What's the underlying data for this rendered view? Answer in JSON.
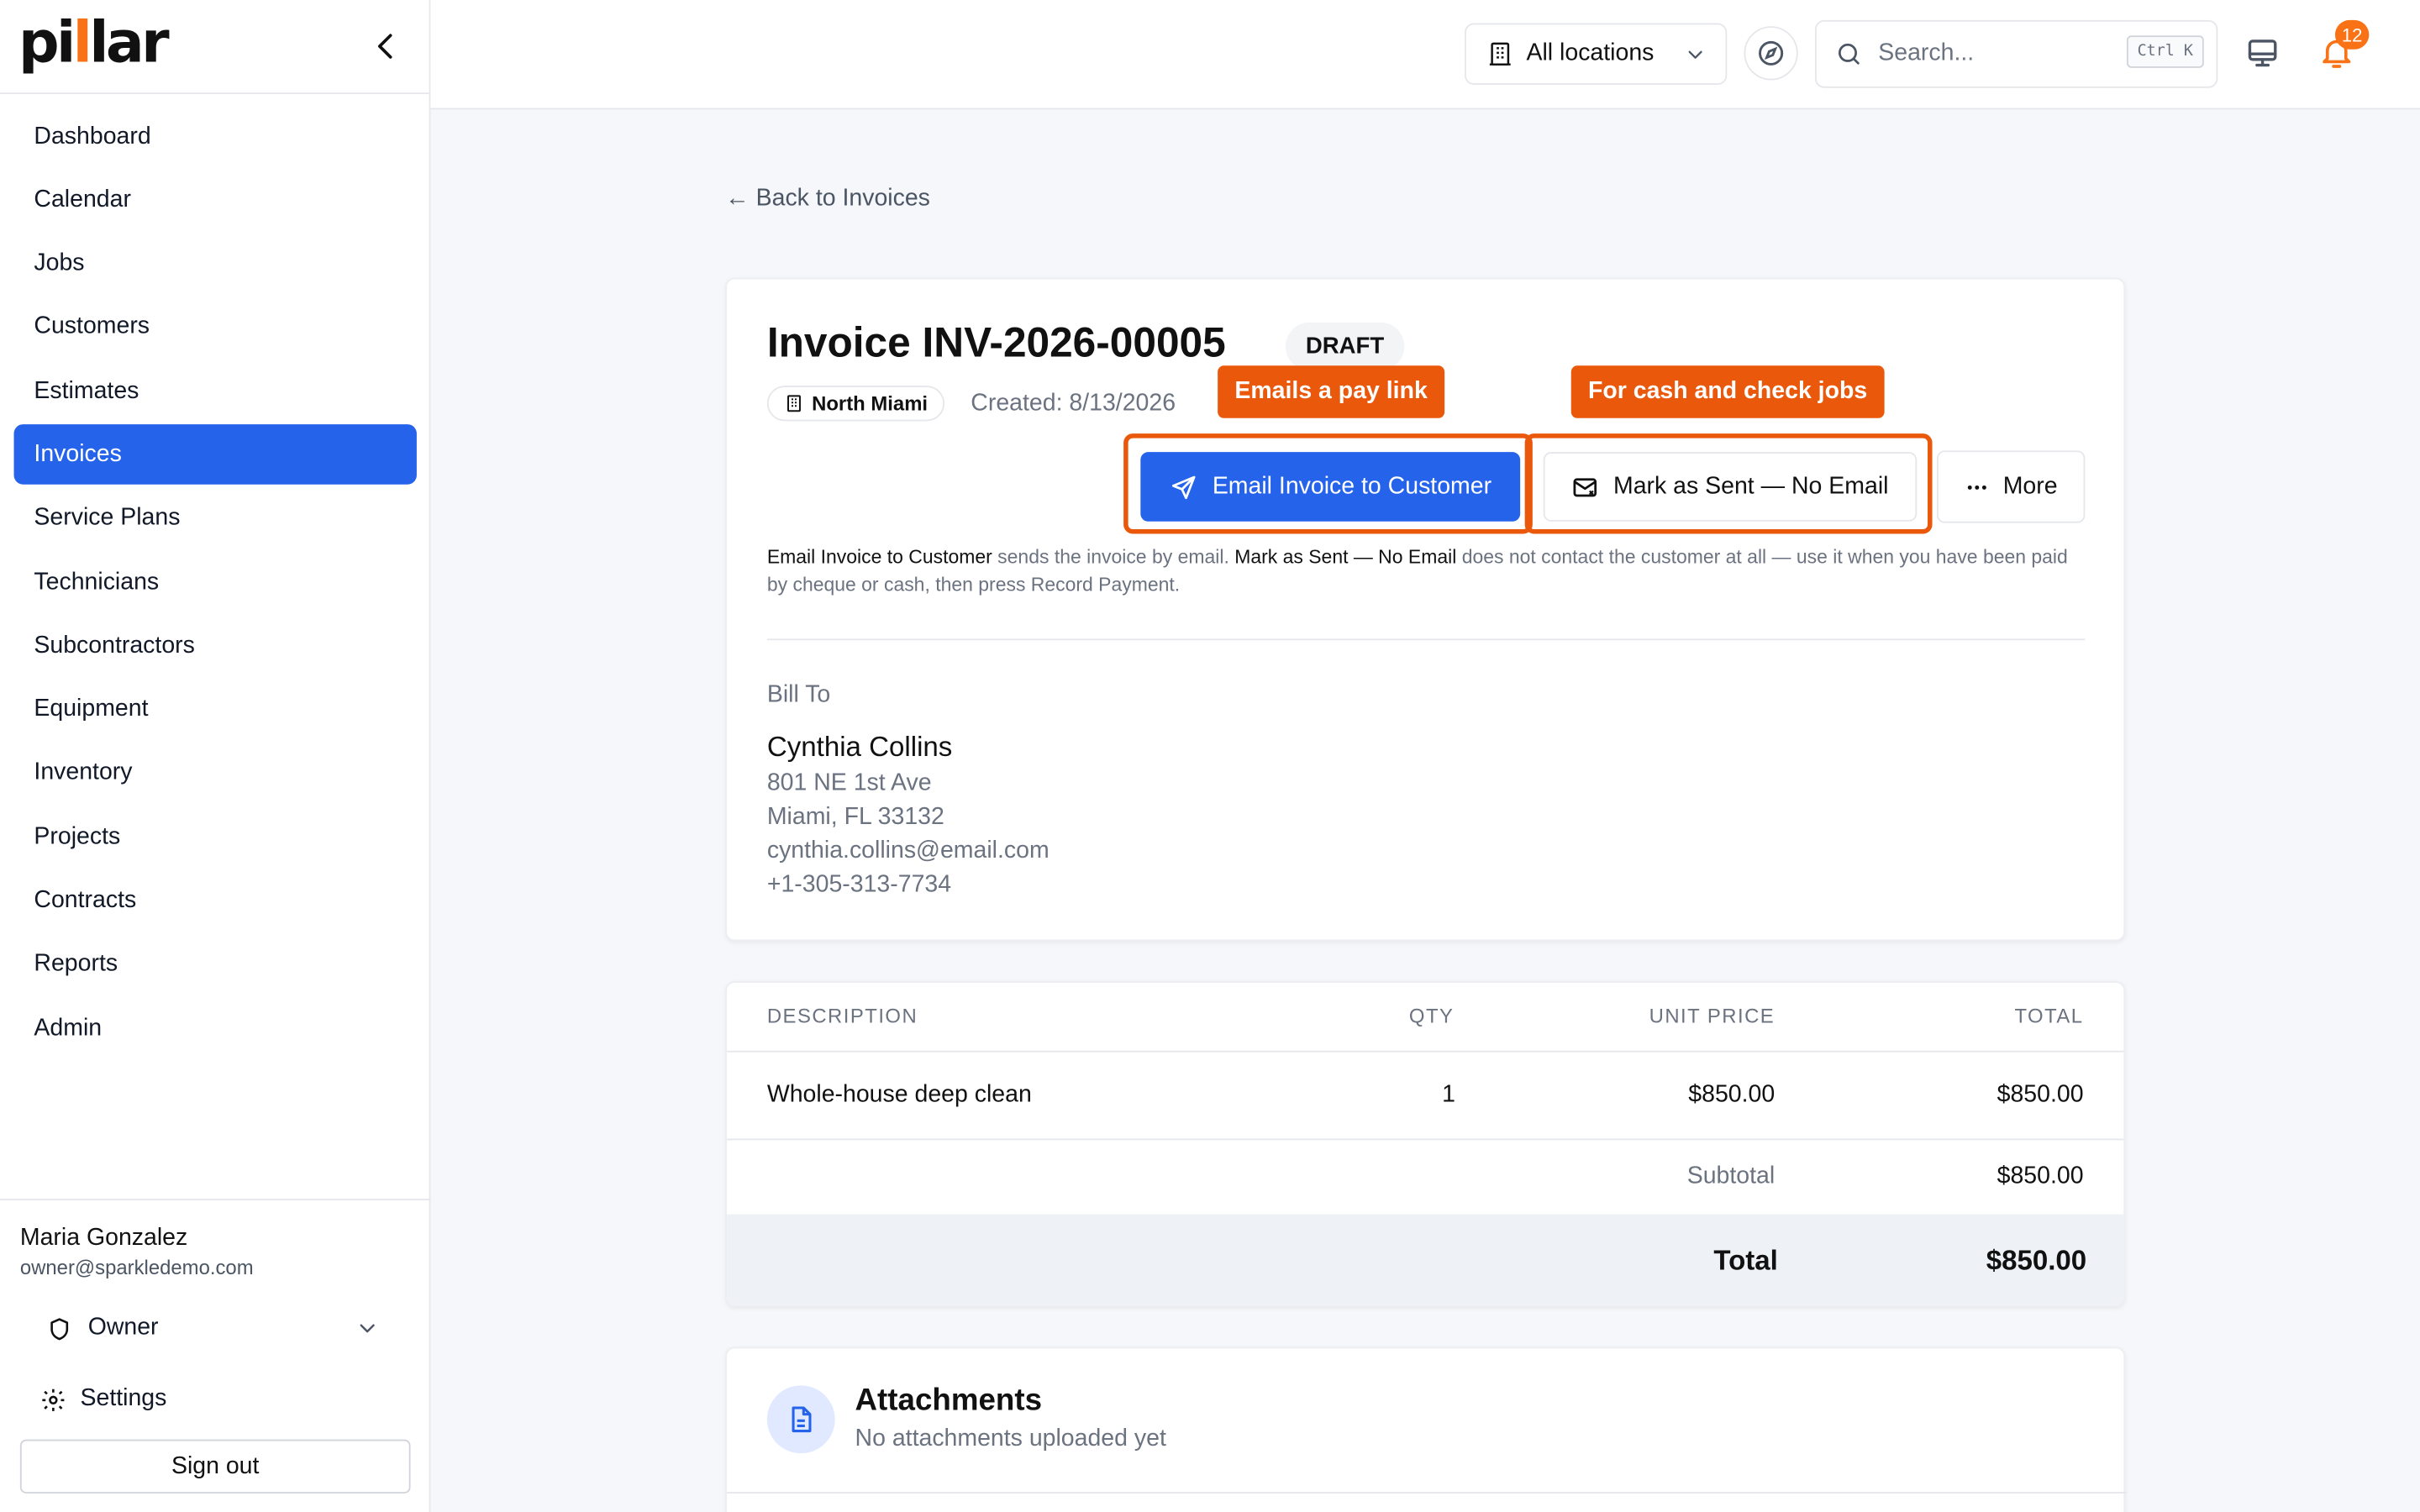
{
  "brand": {
    "logo_text": "pillar",
    "accent": "#2563eb",
    "callout_color": "#ea580c",
    "notification_color": "#f97316"
  },
  "sidebar": {
    "items": [
      {
        "label": "Dashboard"
      },
      {
        "label": "Calendar"
      },
      {
        "label": "Jobs"
      },
      {
        "label": "Customers"
      },
      {
        "label": "Estimates"
      },
      {
        "label": "Invoices",
        "active": true
      },
      {
        "label": "Service Plans"
      },
      {
        "label": "Technicians"
      },
      {
        "label": "Subcontractors"
      },
      {
        "label": "Equipment"
      },
      {
        "label": "Inventory"
      },
      {
        "label": "Projects"
      },
      {
        "label": "Contracts"
      },
      {
        "label": "Reports"
      },
      {
        "label": "Admin"
      }
    ],
    "user": {
      "name": "Maria Gonzalez",
      "email": "owner@sparkledemo.com"
    },
    "role": "Owner",
    "settings_label": "Settings",
    "signout_label": "Sign out"
  },
  "topbar": {
    "location_label": "All locations",
    "search_placeholder": "Search...",
    "search_shortcut": "Ctrl K",
    "notification_count": "12"
  },
  "invoice": {
    "back_label": "← Back to Invoices",
    "title": "Invoice INV-2026-00005",
    "status": "DRAFT",
    "location": "North Miami",
    "created": "Created: 8/13/2026",
    "email_button": "Email Invoice to Customer",
    "mark_sent_button": "Mark as Sent — No Email",
    "more_button": "More",
    "help": {
      "t1": "Email Invoice to Customer",
      "t2": " sends the invoice by email. ",
      "t3": "Mark as Sent — No Email",
      "t4": " does not contact the customer at all — use it when you have been paid by cheque or cash, then press Record Payment."
    },
    "bill_to_label": "Bill To",
    "customer": {
      "name": "Cynthia Collins",
      "address1": "801 NE 1st Ave",
      "address2": "Miami, FL 33132",
      "email": "cynthia.collins@email.com",
      "phone": "+1-305-313-7734"
    }
  },
  "callouts": {
    "email": "Emails a pay link",
    "mark": "For cash and check jobs"
  },
  "line_items": {
    "headers": {
      "description": "DESCRIPTION",
      "qty": "QTY",
      "unit_price": "UNIT PRICE",
      "total": "TOTAL"
    },
    "rows": [
      {
        "description": "Whole-house deep clean",
        "qty": "1",
        "unit_price": "$850.00",
        "total": "$850.00"
      }
    ],
    "subtotal_label": "Subtotal",
    "subtotal": "$850.00",
    "total_label": "Total",
    "total": "$850.00"
  },
  "attachments": {
    "title": "Attachments",
    "subtitle": "No attachments uploaded yet"
  }
}
